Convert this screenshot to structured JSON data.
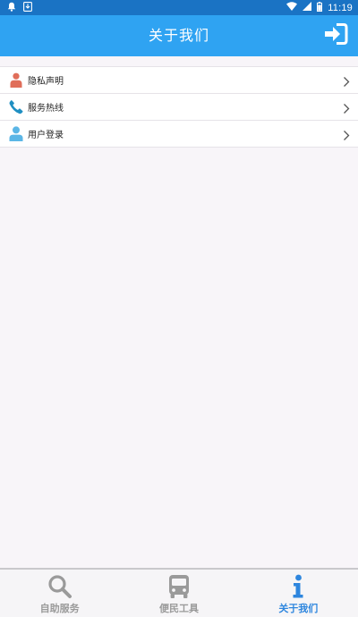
{
  "status_bar": {
    "time": "11:19",
    "left_icons": [
      "notification-bell-icon",
      "download-icon"
    ],
    "right_icons": [
      "wifi-icon",
      "signal-icon",
      "battery-icon"
    ]
  },
  "app_bar": {
    "title": "关于我们",
    "action_icon": "login-icon"
  },
  "menu": {
    "items": [
      {
        "label": "隐私声明",
        "icon": "person-icon",
        "icon_color": "#e06e5a"
      },
      {
        "label": "服务热线",
        "icon": "phone-icon",
        "icon_color": "#1f8fc2"
      },
      {
        "label": "用户登录",
        "icon": "user-icon",
        "icon_color": "#5bb6e6"
      }
    ]
  },
  "bottom_nav": {
    "items": [
      {
        "label": "自助服务",
        "icon": "search-icon",
        "active": false
      },
      {
        "label": "便民工具",
        "icon": "bus-icon",
        "active": false
      },
      {
        "label": "关于我们",
        "icon": "info-icon",
        "active": true
      }
    ]
  },
  "colors": {
    "status_bar": "#1a73c4",
    "app_bar": "#2fa3f2",
    "background": "#f8f5f9",
    "nav_active": "#2e86de",
    "nav_inactive": "#9a9a9a"
  }
}
